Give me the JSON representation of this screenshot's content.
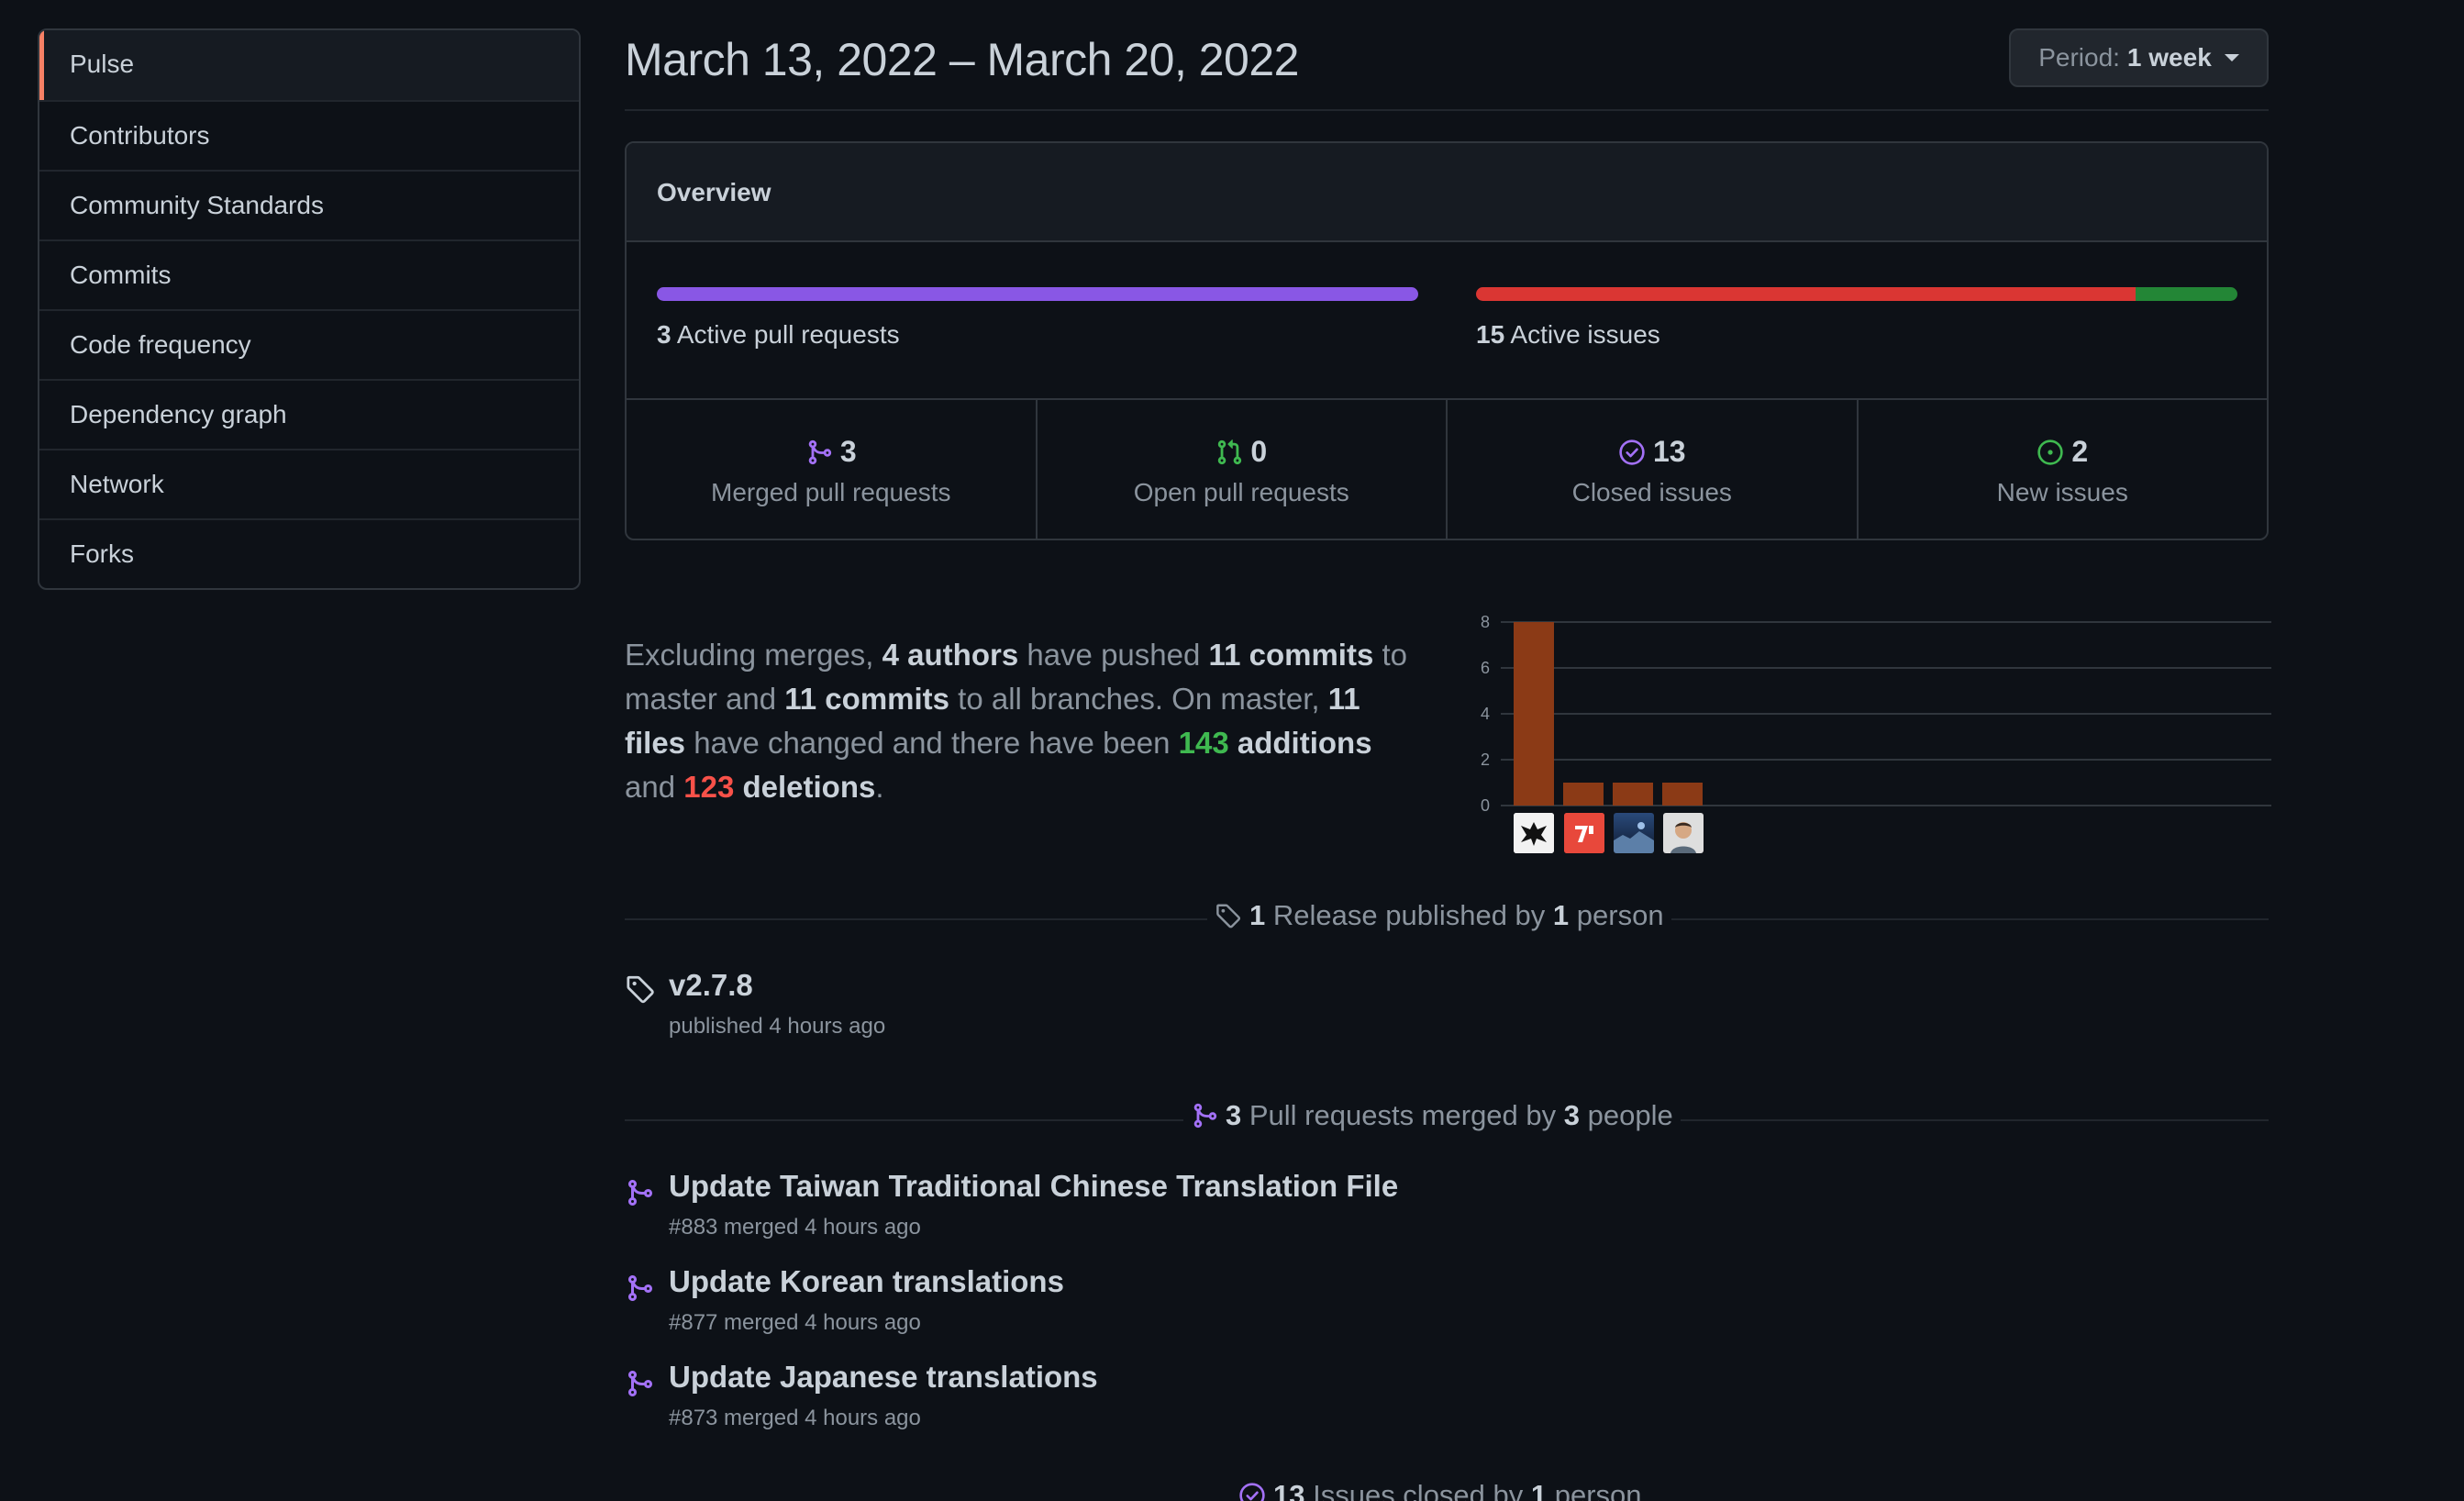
{
  "sidebar": {
    "items": [
      {
        "label": "Pulse",
        "active": true
      },
      {
        "label": "Contributors"
      },
      {
        "label": "Community Standards"
      },
      {
        "label": "Commits"
      },
      {
        "label": "Code frequency"
      },
      {
        "label": "Dependency graph"
      },
      {
        "label": "Network"
      },
      {
        "label": "Forks"
      }
    ]
  },
  "header": {
    "title": "March 13, 2022 – March 20, 2022",
    "period_prefix": "Period:",
    "period_value": "1 week"
  },
  "overview": {
    "heading": "Overview",
    "active_prs_count": "3",
    "active_prs_label": "Active pull requests",
    "active_issues_count": "15",
    "active_issues_label": "Active issues",
    "closed_issue_fraction": 0.866,
    "stats": [
      {
        "value": "3",
        "label": "Merged pull requests",
        "icon": "git-merge-icon",
        "color": "#a371f7"
      },
      {
        "value": "0",
        "label": "Open pull requests",
        "icon": "git-pull-request-icon",
        "color": "#3fb950"
      },
      {
        "value": "13",
        "label": "Closed issues",
        "icon": "issue-closed-icon",
        "color": "#a371f7"
      },
      {
        "value": "2",
        "label": "New issues",
        "icon": "issue-opened-icon",
        "color": "#3fb950"
      }
    ]
  },
  "summary": {
    "t1": "Excluding merges, ",
    "authors": "4 authors",
    "t2": " have pushed ",
    "commits_master": "11 commits",
    "t3": " to master and ",
    "commits_all": "11 commits",
    "t4": " to all branches. On master, ",
    "files": "11 files",
    "t5": " have changed and there have been ",
    "additions_num": "143",
    "additions_word": " additions",
    "t6": " and ",
    "deletions_num": "123",
    "deletions_word": " deletions",
    "t7": "."
  },
  "chart_data": {
    "type": "bar",
    "categories": [
      "author-1",
      "author-2",
      "author-3",
      "author-4"
    ],
    "values": [
      8,
      1,
      1,
      1
    ],
    "ylim": [
      0,
      8
    ],
    "yticks": [
      "0",
      "2",
      "4",
      "6",
      "8"
    ],
    "bar_color": "#8b3a16",
    "grid": true
  },
  "releases": {
    "count": "1",
    "label_mid": " Release published by ",
    "people": "1",
    "label_end": " person",
    "items": [
      {
        "tag": "v2.7.8",
        "meta": "published 4 hours ago"
      }
    ]
  },
  "pull_requests": {
    "count": "3",
    "label_mid": " Pull requests merged by ",
    "people": "3",
    "label_end": " people",
    "items": [
      {
        "title": "Update Taiwan Traditional Chinese Translation File",
        "meta": "#883 merged 4 hours ago"
      },
      {
        "title": "Update Korean translations",
        "meta": "#877 merged 4 hours ago"
      },
      {
        "title": "Update Japanese translations",
        "meta": "#873 merged 4 hours ago"
      }
    ]
  },
  "issues_closed": {
    "count": "13",
    "label_mid": " Issues closed by ",
    "people": "1",
    "label_end": " person"
  }
}
